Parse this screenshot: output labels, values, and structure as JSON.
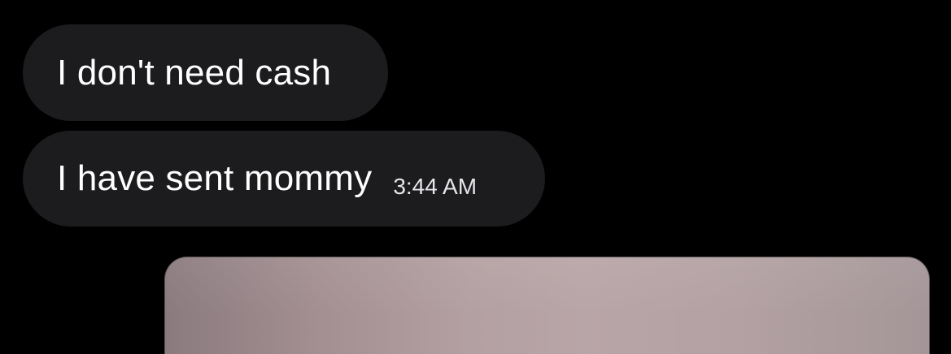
{
  "messages": [
    {
      "text": "I don't need cash"
    },
    {
      "text": "I have sent mommy",
      "timestamp": "3:44 AM"
    }
  ],
  "colors": {
    "background": "#000000",
    "bubble": "#1c1c1e",
    "text": "#ffffff"
  }
}
